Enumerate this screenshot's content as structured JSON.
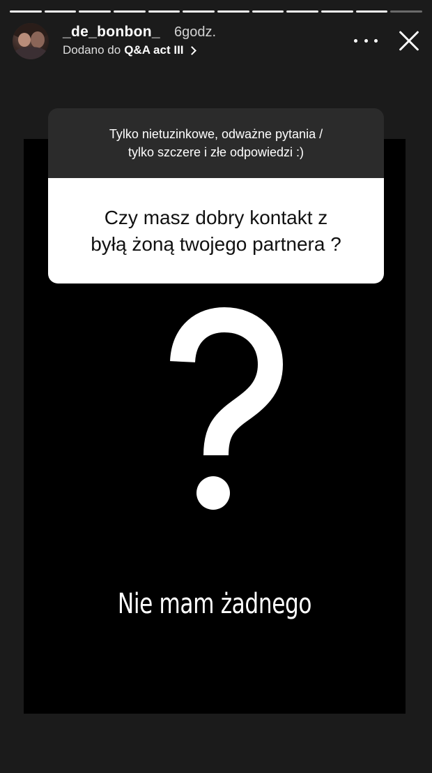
{
  "story": {
    "progress_segments": 12,
    "progress_completed": 11
  },
  "header": {
    "username": "_de_bonbon_",
    "time": "6godz.",
    "added_prefix": "Dodano do",
    "album": "Q&A act III"
  },
  "qa": {
    "prompt_line1": "Tylko nietuzinkowe, odważne pytania /",
    "prompt_line2": "tylko szczere i złe odpowiedzi :)",
    "question_line1": "Czy masz dobry kontakt z",
    "question_line2": "byłą żoną twojego partnera ?"
  },
  "content": {
    "symbol": "?",
    "answer": "Nie mam żadnego"
  },
  "icons": {
    "more": "more-horizontal-icon",
    "close": "close-icon",
    "chevron": "chevron-right-icon"
  },
  "colors": {
    "background": "#1b1b1b",
    "panel": "#000000",
    "card_head": "#2b2b2b",
    "card_body": "#ffffff"
  }
}
